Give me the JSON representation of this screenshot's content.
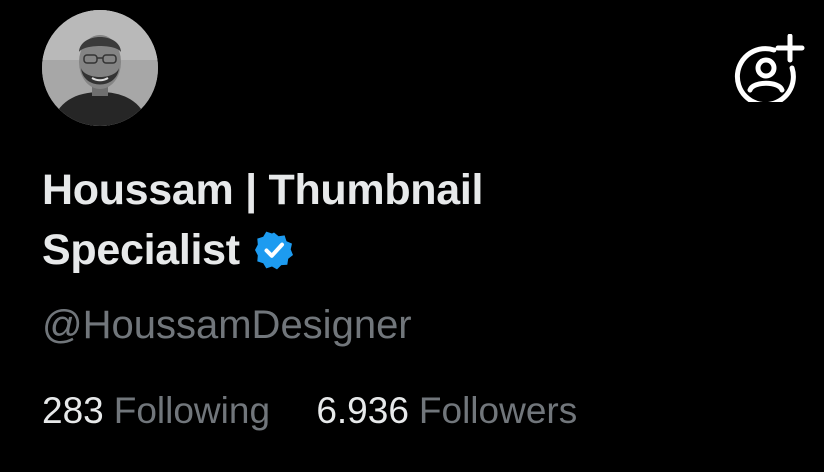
{
  "profile": {
    "display_name": "Houssam | Thumbnail Specialist",
    "handle": "@HoussamDesigner",
    "verified": true
  },
  "stats": {
    "following_count": "283",
    "following_label": "Following",
    "followers_count": "6.936",
    "followers_label": "Followers"
  },
  "icons": {
    "avatar": "avatar-photo",
    "follow": "add-user-icon",
    "verified": "verified-badge-icon"
  },
  "colors": {
    "background": "#000000",
    "primary_text": "#e7e9ea",
    "secondary_text": "#71767b",
    "verified_badge": "#1d9bf0"
  }
}
